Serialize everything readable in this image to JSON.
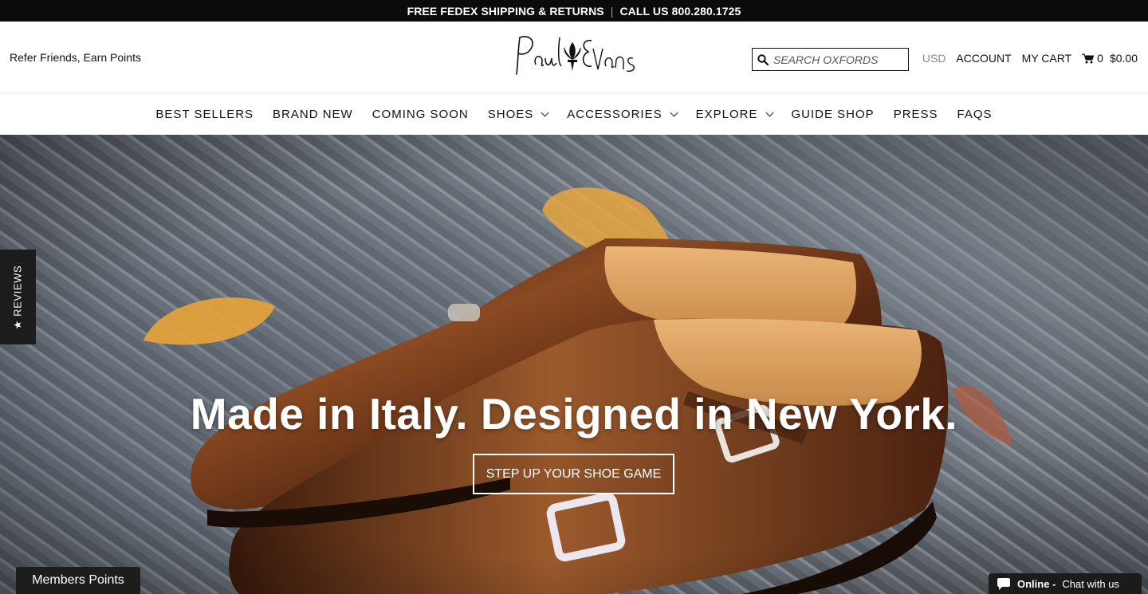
{
  "topbar": {
    "shipping": "FREE FEDEX SHIPPING & RETURNS",
    "separator": "|",
    "phone": "CALL US 800.280.1725"
  },
  "header": {
    "refer": "Refer Friends, Earn Points",
    "logo_text": "Paul Evans",
    "search_placeholder": "SEARCH OXFORDS",
    "currency": "USD",
    "account": "ACCOUNT",
    "my_cart": "MY CART",
    "cart_count": "0",
    "cart_total": "$0.00"
  },
  "nav": {
    "items": [
      {
        "label": "BEST SELLERS"
      },
      {
        "label": "BRAND NEW"
      },
      {
        "label": "COMING SOON"
      },
      {
        "label": "SHOES"
      },
      {
        "label": "ACCESSORIES"
      },
      {
        "label": "EXPLORE"
      },
      {
        "label": "GUIDE SHOP"
      },
      {
        "label": "PRESS"
      },
      {
        "label": "FAQS"
      }
    ]
  },
  "hero": {
    "title": "Made in Italy. Designed in New York.",
    "cta": "STEP UP YOUR SHOE GAME"
  },
  "widgets": {
    "reviews": "★ REVIEWS",
    "members": "Members Points",
    "chat_status": "Online -",
    "chat_text": "Chat with us"
  },
  "colors": {
    "topbar_bg": "#0b0b0b",
    "leather": "#6b3417",
    "hero_ground": "#707780"
  }
}
